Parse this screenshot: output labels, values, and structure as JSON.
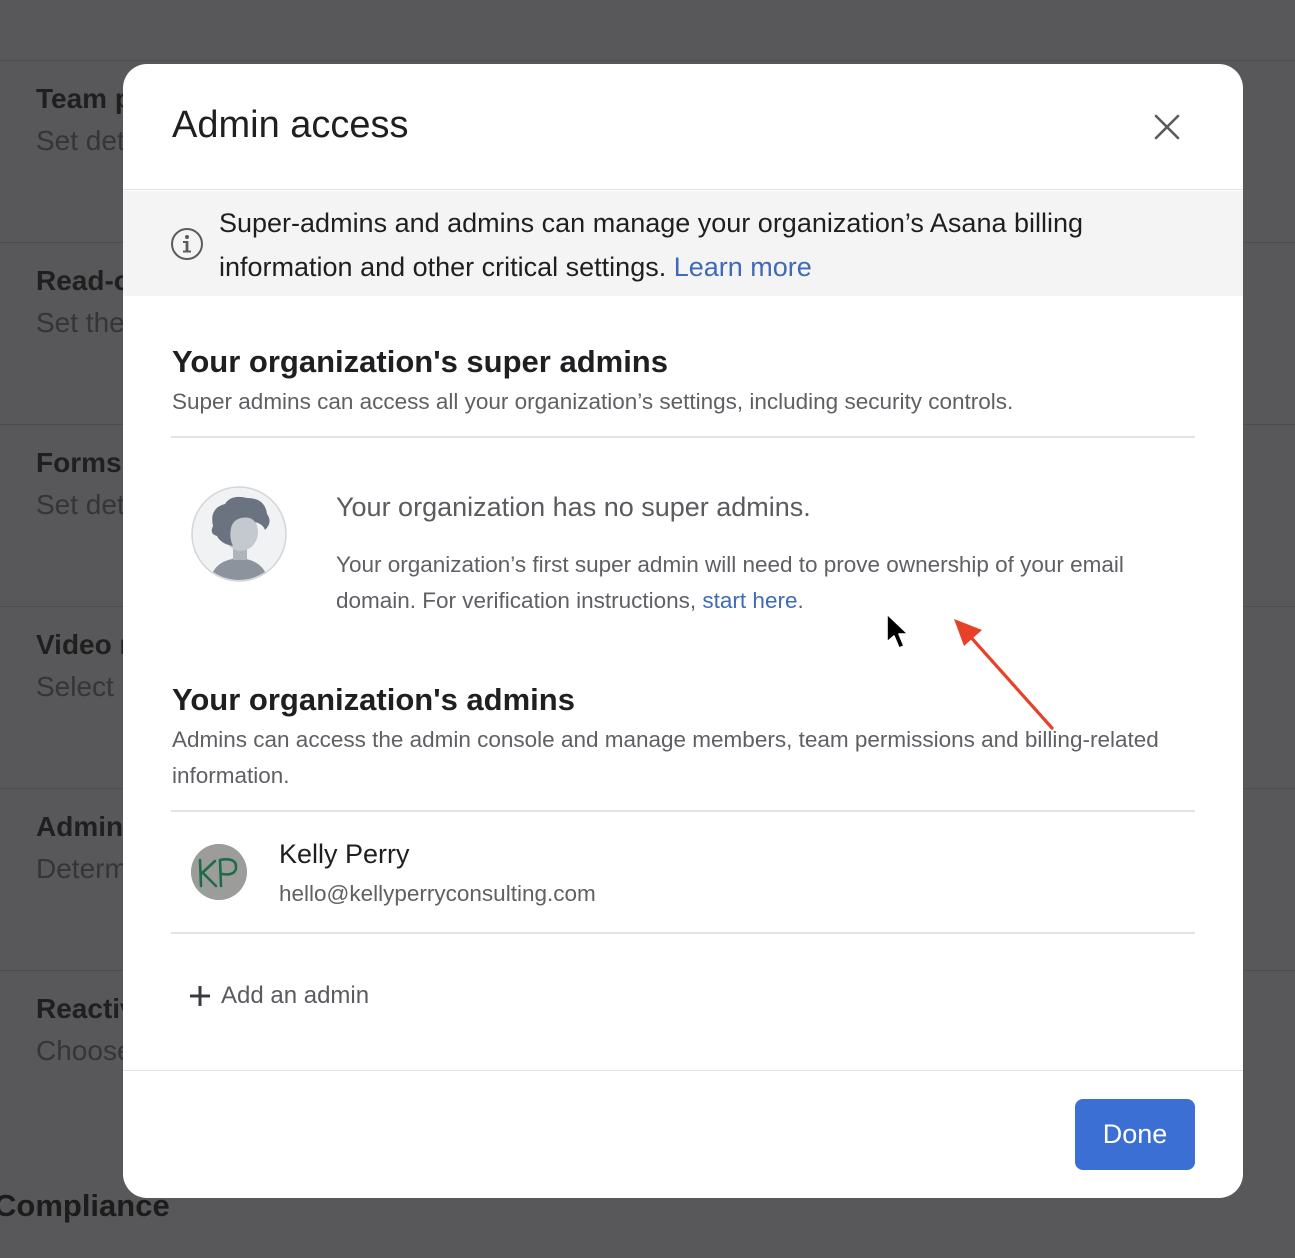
{
  "background": {
    "rows": [
      {
        "title": "Team p",
        "subtitle": "Set det"
      },
      {
        "title": "Read-o",
        "subtitle": "Set the"
      },
      {
        "title": "Forms",
        "subtitle": "Set det"
      },
      {
        "title": "Video r",
        "subtitle": "Select"
      },
      {
        "title": "Admin",
        "subtitle": "Determ"
      },
      {
        "title": "Reactiv",
        "subtitle": "Choose"
      }
    ],
    "section_heading": "Compliance"
  },
  "modal": {
    "title": "Admin access",
    "close_icon": "close-icon",
    "info_banner": {
      "icon": "info-icon",
      "text": "Super-admins and admins can manage your organization’s Asana billing information and other critical settings.",
      "link": "Learn more"
    },
    "super_admins": {
      "title": "Your organization's super admins",
      "description": "Super admins can access all your organization’s settings, including security controls.",
      "empty_state": {
        "title": "Your organization has no super admins.",
        "description": "Your organization’s first super admin will need to prove ownership of your email domain. For verification instructions,",
        "link": "start here",
        "link_suffix": "."
      }
    },
    "admins": {
      "title": "Your organization's admins",
      "description": "Admins can access the admin console and manage members, team permissions and billing-related information.",
      "members": [
        {
          "initials": "KP",
          "name": "Kelly Perry",
          "email": "hello@kellyperryconsulting.com"
        }
      ],
      "add_label": "Add an admin",
      "add_icon": "plus-icon"
    },
    "footer": {
      "done_label": "Done"
    }
  },
  "colors": {
    "accent": "#3b6fd3",
    "link": "#3f6ab8",
    "annotation_arrow": "#e8412a"
  }
}
